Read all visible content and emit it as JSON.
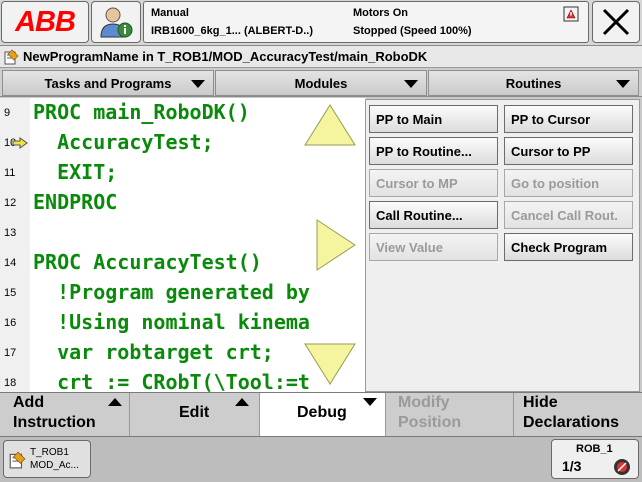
{
  "header": {
    "logo_text": "ABB",
    "status_mode": "Manual",
    "status_controller": "IRB1600_6kg_1... (ALBERT-D..)",
    "status_motors": "Motors On",
    "status_state": "Stopped (Speed 100%)"
  },
  "path": {
    "text": "NewProgramName  in  T_ROB1/MOD_AccuracyTest/main_RoboDK"
  },
  "menus": [
    {
      "label": "Tasks and Programs"
    },
    {
      "label": "Modules"
    },
    {
      "label": "Routines"
    }
  ],
  "code": {
    "lines": [
      {
        "num": "9",
        "text": "PROC main_RoboDK()"
      },
      {
        "num": "10",
        "text": "  AccuracyTest;"
      },
      {
        "num": "11",
        "text": "  EXIT;"
      },
      {
        "num": "12",
        "text": "ENDPROC"
      },
      {
        "num": "13",
        "text": ""
      },
      {
        "num": "14",
        "text": "PROC AccuracyTest()"
      },
      {
        "num": "15",
        "text": "  !Program generated by"
      },
      {
        "num": "16",
        "text": "  !Using nominal kinema"
      },
      {
        "num": "17",
        "text": "  var robtarget crt;"
      },
      {
        "num": "18",
        "text": "  crt := CRobT(\\Tool:=t"
      }
    ]
  },
  "debug_menu": {
    "pp_to_main": "PP to Main",
    "pp_to_cursor": "PP to Cursor",
    "pp_to_routine": "PP to Routine...",
    "cursor_to_pp": "Cursor to PP",
    "cursor_to_mp": "Cursor to MP",
    "go_to_position": "Go to position",
    "call_routine": "Call Routine...",
    "cancel_call_rout": "Cancel Call Rout.",
    "view_value": "View Value",
    "check_program": "Check Program"
  },
  "commands": {
    "add_instruction_1": "Add",
    "add_instruction_2": "Instruction",
    "edit": "Edit",
    "debug": "Debug",
    "modify_position_1": "Modify",
    "modify_position_2": "Position",
    "hide_declarations_1": "Hide",
    "hide_declarations_2": "Declarations"
  },
  "taskbar": {
    "task_line1": "T_ROB1",
    "task_line2": "MOD_Ac...",
    "rob_label": "ROB_1",
    "rob_fraction": "1/3"
  },
  "colors": {
    "code_text": "#0a8a0a",
    "logo_red": "#ff0000",
    "scroll_triangle": "#f5f5a0"
  }
}
